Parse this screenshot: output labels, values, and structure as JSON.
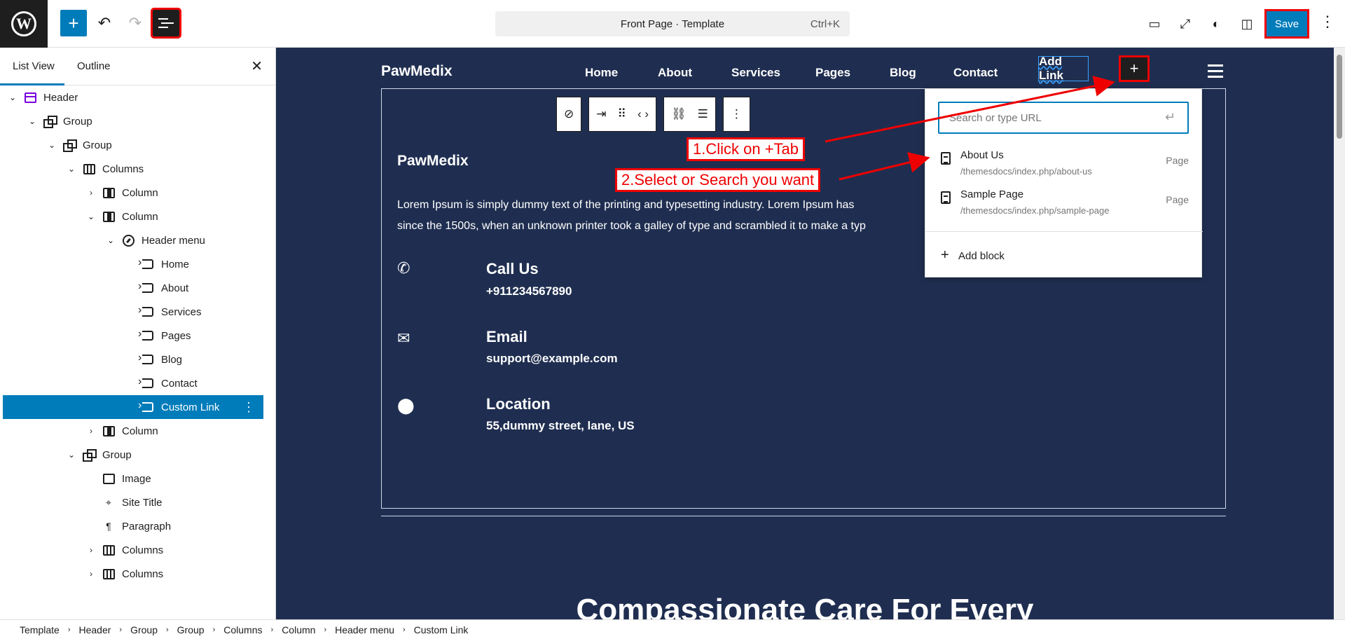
{
  "topbar": {
    "doc_title": "Front Page · Template",
    "shortcut": "Ctrl+K",
    "save_label": "Save",
    "icons": [
      "wordpress-logo-icon",
      "plus-icon",
      "undo-icon",
      "redo-icon",
      "list-view-icon",
      "desktop-preview-icon",
      "fullscreen-icon",
      "contrast-icon",
      "sidebar-toggle-icon",
      "more-vertical-icon"
    ]
  },
  "sidebar": {
    "tab_list_view": "List View",
    "tab_outline": "Outline",
    "items": [
      {
        "label": "Header"
      },
      {
        "label": "Group"
      },
      {
        "label": "Group"
      },
      {
        "label": "Columns"
      },
      {
        "label": "Column"
      },
      {
        "label": "Column"
      },
      {
        "label": "Header menu"
      },
      {
        "label": "Home"
      },
      {
        "label": "About"
      },
      {
        "label": "Services"
      },
      {
        "label": "Pages"
      },
      {
        "label": "Blog"
      },
      {
        "label": "Contact"
      },
      {
        "label": "Custom Link"
      },
      {
        "label": "Column"
      },
      {
        "label": "Group"
      },
      {
        "label": "Image"
      },
      {
        "label": "Site Title"
      },
      {
        "label": "Paragraph"
      },
      {
        "label": "Columns"
      },
      {
        "label": "Columns"
      }
    ]
  },
  "breadcrumbs": [
    "Template",
    "Header",
    "Group",
    "Group",
    "Columns",
    "Column",
    "Header menu",
    "Custom Link"
  ],
  "canvas": {
    "site_name": "PawMedix",
    "nav": [
      "Home",
      "About",
      "Services",
      "Pages",
      "Blog",
      "Contact"
    ],
    "add_link": "Add Link",
    "content_title": "PawMedix",
    "lorem_line1": "Lorem Ipsum is simply dummy text of the printing and typesetting industry. Lorem Ipsum has",
    "lorem_line2": "since the 1500s, when an unknown printer took a galley of type and scrambled it to make a typ",
    "contacts": [
      {
        "icon": "phone-icon",
        "heading": "Call Us",
        "value": "+911234567890"
      },
      {
        "icon": "envelope-icon",
        "heading": "Email",
        "value": "support@example.com"
      },
      {
        "icon": "location-pin-icon",
        "heading": "Location",
        "value": "55,dummy street, lane, US"
      }
    ],
    "headline": "Compassionate Care For Every"
  },
  "link_popover": {
    "placeholder": "Search or type URL",
    "suggestions": [
      {
        "title": "About Us",
        "path": "/themesdocs/index.php/about-us",
        "type": "Page"
      },
      {
        "title": "Sample Page",
        "path": "/themesdocs/index.php/sample-page",
        "type": "Page"
      }
    ],
    "add_block": "Add block"
  },
  "annotations": {
    "step1": "1.Click on +Tab",
    "step2": "2.Select or Search you want",
    "color": "#e00000"
  },
  "colors": {
    "accent": "#007cba",
    "canvas_bg": "#1f2e50"
  }
}
